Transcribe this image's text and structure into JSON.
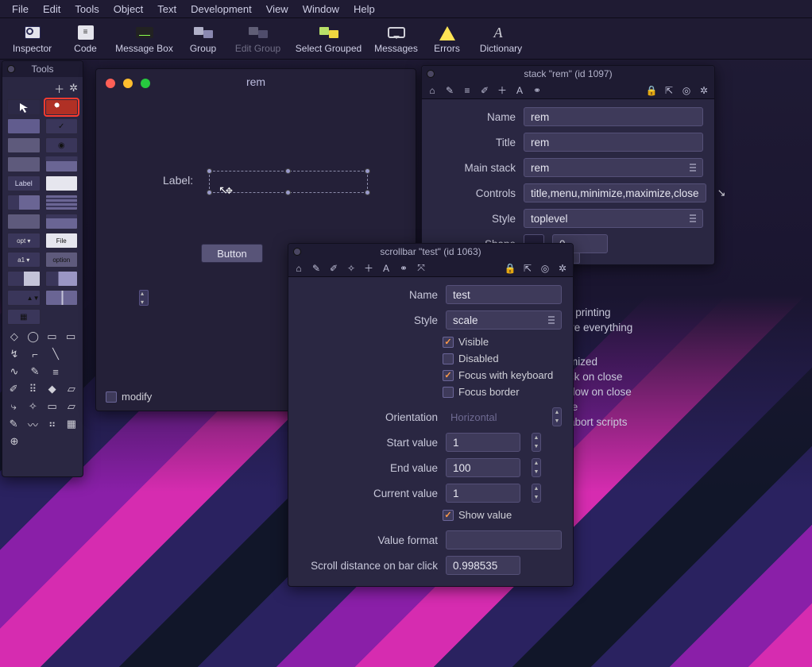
{
  "menubar": [
    "File",
    "Edit",
    "Tools",
    "Object",
    "Text",
    "Development",
    "View",
    "Window",
    "Help"
  ],
  "toolbar": [
    {
      "name": "inspector",
      "label": "Inspector"
    },
    {
      "name": "code",
      "label": "Code"
    },
    {
      "name": "message-box",
      "label": "Message Box"
    },
    {
      "name": "group",
      "label": "Group"
    },
    {
      "name": "edit-group",
      "label": "Edit Group",
      "dim": true
    },
    {
      "name": "select-grouped",
      "label": "Select Grouped"
    },
    {
      "name": "messages",
      "label": "Messages"
    },
    {
      "name": "errors",
      "label": "Errors"
    },
    {
      "name": "dictionary",
      "label": "Dictionary"
    }
  ],
  "tools_palette": {
    "title": "Tools"
  },
  "editor": {
    "title": "rem",
    "label_text": "Label:",
    "button_text": "Button",
    "modify_text": "modify"
  },
  "stack_inspector": {
    "title": "stack \"rem\" (id 1097)",
    "rows": {
      "name_lab": "Name",
      "name_val": "rem",
      "title_lab": "Title",
      "title_val": "rem",
      "mainstack_lab": "Main stack",
      "mainstack_val": "rem",
      "controls_lab": "Controls",
      "controls_val": "title,menu,minimize,maximize,close",
      "style_lab": "Style",
      "style_val": "toplevel",
      "shape_lab": "Shape",
      "shape_val": "0"
    }
  },
  "peek": {
    "lines": [
      "r printing",
      "ve everything",
      "",
      "mized",
      "ck on close",
      "dow on close",
      "te",
      "abort scripts"
    ]
  },
  "scrollbar_inspector": {
    "title": "scrollbar \"test\" (id 1063)",
    "name_lab": "Name",
    "name_val": "test",
    "style_lab": "Style",
    "style_val": "scale",
    "visible_lab": "Visible",
    "visible_chk": true,
    "disabled_lab": "Disabled",
    "disabled_chk": false,
    "focuskb_lab": "Focus with keyboard",
    "focuskb_chk": true,
    "focusbd_lab": "Focus border",
    "focusbd_chk": false,
    "orient_lab": "Orientation",
    "orient_val": "Horizontal",
    "start_lab": "Start value",
    "start_val": "1",
    "end_lab": "End value",
    "end_val": "100",
    "curr_lab": "Current value",
    "curr_val": "1",
    "showv_lab": "Show value",
    "showv_chk": true,
    "fmt_lab": "Value format",
    "fmt_val": "",
    "scroll_lab": "Scroll distance on bar click",
    "scroll_val": "0.998535"
  }
}
